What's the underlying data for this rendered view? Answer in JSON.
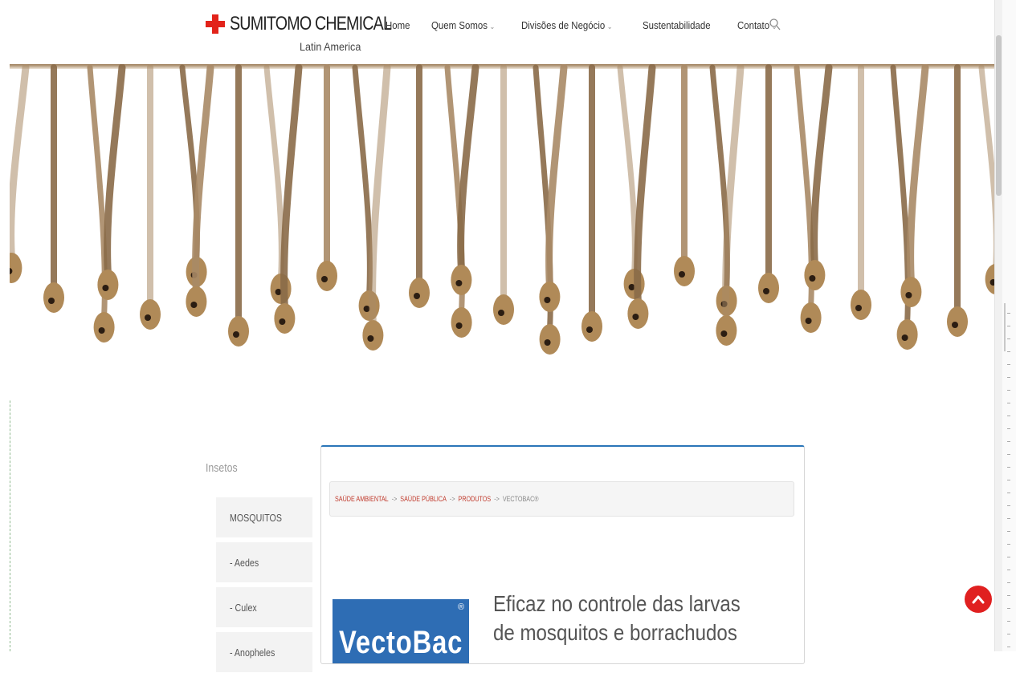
{
  "brand": {
    "name": "SUMITOMO CHEMICAL",
    "region": "Latin America",
    "accent": "#e2231a"
  },
  "nav": {
    "items": [
      {
        "label": "Home",
        "has_dropdown": false
      },
      {
        "label": "Quem Somos",
        "has_dropdown": true
      },
      {
        "label": "Divisões de Negócio",
        "has_dropdown": true
      },
      {
        "label": "Sustentabilidade",
        "has_dropdown": false
      },
      {
        "label": "Contato",
        "has_dropdown": true
      }
    ],
    "chevron": "⌄",
    "search_icon": "search-icon"
  },
  "sidebar": {
    "title": "Insetos",
    "items": [
      {
        "label": "MOSQUITOS"
      },
      {
        "label": "- Aedes"
      },
      {
        "label": "- Culex"
      },
      {
        "label": "- Anopheles"
      }
    ]
  },
  "breadcrumb": {
    "items": [
      "SAÚDE AMBIENTAL",
      "SAÚDE PÚBLICA",
      "PRODUTOS",
      "VECTOBAC®"
    ],
    "separator": "->"
  },
  "product": {
    "logo_text": "VectoBac",
    "logo_mark": "®",
    "logo_color": "#2e6db4",
    "headline": "Eficaz no controle das larvas de mosquitos e borrachudos"
  },
  "back_to_top": {
    "icon": "chevron-up-icon",
    "color": "#e02020"
  }
}
